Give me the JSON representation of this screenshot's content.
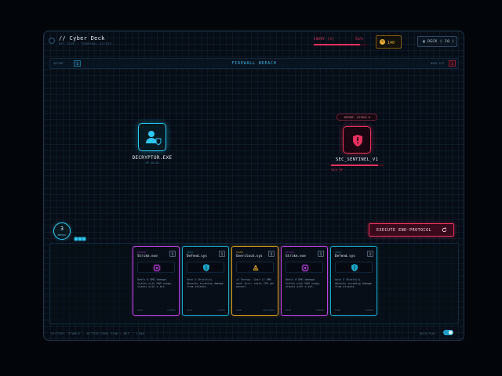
{
  "header": {
    "title": "// Cyber Deck",
    "subtitle": "NET DIVE · TERMINAL ACCESS",
    "enemy_label": "ENEMY [3]",
    "enemy_value": "54/4",
    "credits": "140",
    "deck_label": "DECK ( 10 )"
  },
  "band": {
    "left_label": "SECTOR",
    "left_counter": "1",
    "title": "FIREWALL BREACH",
    "right_label": "NODE 0/3",
    "right_counter": "3"
  },
  "player": {
    "name": "DECRYPTOR.EXE",
    "status": "HP 40/40",
    "icon": "user-shield-icon"
  },
  "enemy": {
    "name": "SEC_SENTINEL_V1",
    "intent": "INTENT: ATTACK 8",
    "shield": "54/4 HP",
    "hp_fraction": 0.88,
    "icon": "shield-alert-icon"
  },
  "energy": {
    "value": "3",
    "label": "ENERGY",
    "pips": 3
  },
  "execute_label": "EXECUTE END-PROTOCOL",
  "cards": [
    {
      "meta": "ATTACK",
      "name": "Strike.exe",
      "cost": "1",
      "desc": "Deals 6 DMG damage. Scales with RAM usage, stacks with a bit.",
      "footer_l": "BASE",
      "footer_r": "COMMON",
      "accent": "#c040e0",
      "icon": "chip-icon"
    },
    {
      "meta": "SKILL",
      "name": "Defend.sys",
      "cost": "1",
      "desc": "Gain 5 Shield(s). Absorbs incoming damage from attacks.",
      "footer_l": "BASE",
      "footer_r": "COMMON",
      "accent": "#1aa8c8",
      "icon": "shield-icon"
    },
    {
      "meta": "POWER",
      "name": "Overclock.sys",
      "cost": "2",
      "desc": "+2 Energy. Gain +1 DMG each turn; costs CPU per packet.",
      "footer_l": "RARE",
      "footer_r": "UNCOMMON",
      "accent": "#d9a020",
      "icon": "overclock-icon"
    },
    {
      "meta": "ATTACK",
      "name": "Strike.exe",
      "cost": "1",
      "desc": "Deals 6 DMG damage. Scales with RAM usage, stacks with a bit.",
      "footer_l": "BASE",
      "footer_r": "COMMON",
      "accent": "#c040e0",
      "icon": "chip-icon"
    },
    {
      "meta": "SKILL",
      "name": "Defend.sys",
      "cost": "1",
      "desc": "Gain 5 Shield(s). Absorbs incoming damage from attacks.",
      "footer_l": "BASE",
      "footer_r": "COMMON",
      "accent": "#1aa8c8",
      "icon": "shield-icon"
    }
  ],
  "footer": {
    "status": "SYSTEM: STABLE · ACTIVE",
    "core": "CORE SYNC: NET · LINK",
    "autoplay_label": "AUTO PLAY"
  }
}
